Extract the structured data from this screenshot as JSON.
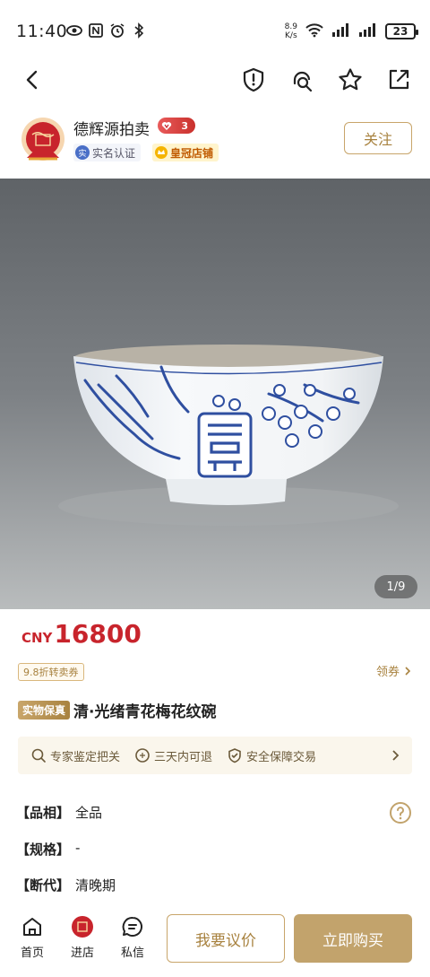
{
  "status": {
    "time": "11:40",
    "net_speed_value": "8.9",
    "net_speed_unit": "K/s",
    "battery": "23"
  },
  "shop": {
    "name": "德辉源拍卖",
    "level": "3",
    "verify_label": "实名认证",
    "verify_icon_text": "实",
    "crown_label": "皇冠店铺",
    "follow_label": "关注"
  },
  "image": {
    "counter": "1/9"
  },
  "price": {
    "currency": "CNY",
    "amount": "16800"
  },
  "coupon": {
    "label": "9.8折转卖券",
    "claim_label": "领券"
  },
  "product": {
    "guarantee_tag": "实物保真",
    "title": "清·光绪青花梅花纹碗"
  },
  "services": [
    {
      "label": "专家鉴定把关",
      "icon": "search-icon"
    },
    {
      "label": "三天内可退",
      "icon": "return-icon"
    },
    {
      "label": "安全保障交易",
      "icon": "shield-check-icon"
    }
  ],
  "attributes": [
    {
      "key": "【品相】",
      "value": "全品"
    },
    {
      "key": "【规格】",
      "value": "-"
    },
    {
      "key": "【断代】",
      "value": "清晚期"
    }
  ],
  "bottom": {
    "home_label": "首页",
    "shop_label": "进店",
    "message_label": "私信",
    "bargain_label": "我要议价",
    "buy_label": "立即购买"
  },
  "colors": {
    "accent_gold": "#c2a36c",
    "price_red": "#c8242c"
  }
}
